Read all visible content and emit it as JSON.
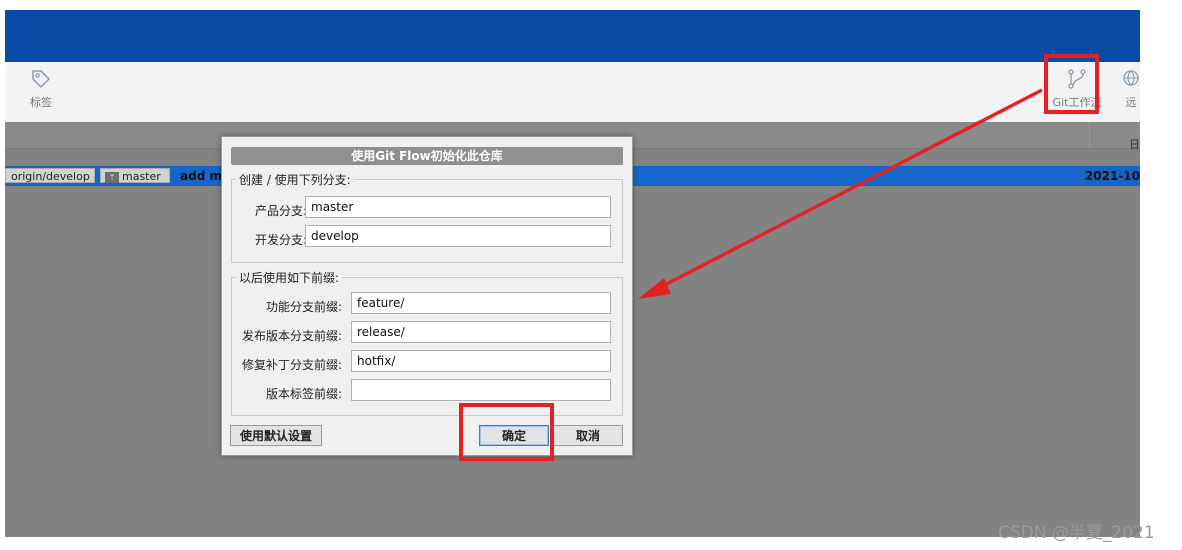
{
  "toolbar": {
    "tag_label": "标签",
    "gitflow_label": "Git工作流",
    "remote_label": "远"
  },
  "branches": {
    "develop": "origin/develop",
    "master": "master",
    "master_icon": "branch-icon"
  },
  "commit": {
    "message": "add m",
    "date": "2021-10"
  },
  "list_header": {
    "date_column_partial": "日"
  },
  "dialog": {
    "title": "使用Git Flow初始化此仓库",
    "branches_group": {
      "legend": "创建 / 使用下列分支:",
      "production_label": "产品分支:",
      "production_value": "master",
      "develop_label": "开发分支:",
      "develop_value": "develop"
    },
    "prefix_group": {
      "legend": "以后使用如下前缀:",
      "feature_label": "功能分支前缀:",
      "feature_value": "feature/",
      "release_label": "发布版本分支前缀:",
      "release_value": "release/",
      "hotfix_label": "修复补丁分支前缀:",
      "hotfix_value": "hotfix/",
      "version_tag_label": "版本标签前缀:",
      "version_tag_value": ""
    },
    "buttons": {
      "use_defaults": "使用默认设置",
      "ok": "确定",
      "cancel": "取消"
    }
  },
  "watermark": "CSDN @半夏_2021",
  "colors": {
    "titlebar": "#0a4aa8",
    "selection": "#1566c8",
    "annotation": "#e52222"
  }
}
